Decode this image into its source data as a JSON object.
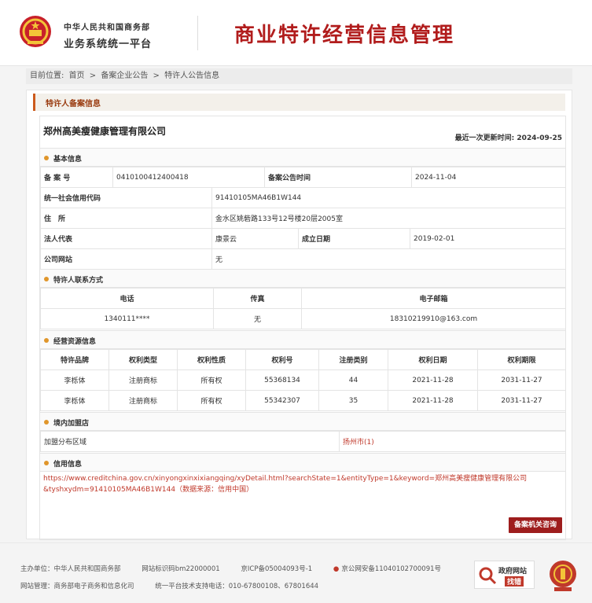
{
  "header": {
    "org_line1": "中华人民共和国商务部",
    "org_line2": "业务系统统一平台",
    "system_title": "商业特许经营信息管理"
  },
  "breadcrumb": {
    "prefix": "目前位置:",
    "items": [
      "首页",
      ">",
      "备案企业公告",
      ">",
      "特许人公告信息"
    ]
  },
  "panel_title": "特许人备案信息",
  "company": {
    "name": "郑州高美瘦健康管理有限公司",
    "updated_label": "最近一次更新时间:",
    "updated_value": "2024-09-25"
  },
  "basic": {
    "section_title": "基本信息",
    "record_no_label": "备 案 号",
    "record_no": "0410100412400418",
    "announce_time_label": "备案公告时间",
    "announce_time": "2024-11-04",
    "credit_code_label": "统一社会信用代码",
    "credit_code": "91410105MA46B1W144",
    "address_label": "住　所",
    "address": "金水区姚砦路133号12号楼20层2005室",
    "legal_rep_label": "法人代表",
    "legal_rep": "康景云",
    "founded_label": "成立日期",
    "founded": "2019-02-01",
    "website_label": "公司网站",
    "website": "无"
  },
  "contact": {
    "section_title": "特许人联系方式",
    "headers": [
      "电话",
      "传真",
      "电子邮箱"
    ],
    "phone": "1340111****",
    "fax": "无",
    "email": "18310219910@163.com"
  },
  "resources": {
    "section_title": "经营资源信息",
    "headers": [
      "特许品牌",
      "权利类型",
      "权利性质",
      "权利号",
      "注册类别",
      "权利日期",
      "权利期限"
    ],
    "rows": [
      [
        "李栎体",
        "注册商标",
        "所有权",
        "55368134",
        "44",
        "2021-11-28",
        "2031-11-27"
      ],
      [
        "李栎体",
        "注册商标",
        "所有权",
        "55342307",
        "35",
        "2021-11-28",
        "2031-11-27"
      ]
    ]
  },
  "domestic": {
    "section_title": "境内加盟店",
    "area_label": "加盟分布区域",
    "area_value": "扬州市(1)"
  },
  "credit": {
    "section_title": "信用信息",
    "text": "https://www.creditchina.gov.cn/xinyongxinxixiangqing/xyDetail.html?searchState=1&entityType=1&keyword=郑州高美瘦健康管理有限公司&tyshxydm=91410105MA46B1W144（数据来源：信用中国）"
  },
  "consult_button": "备案机关咨询",
  "footer": {
    "host": "主办单位：中华人民共和国商务部",
    "site_id": "网站标识码bm22000001",
    "icp": "京ICP备05004093号-1",
    "police": "京公网安备11040102700091号",
    "manager": "网站管理：商务部电子商务和信息化司",
    "support": "统一平台技术支持电话：010-67800108、67801644",
    "gov_badge_line1": "政府网站",
    "gov_badge_line2": "找错"
  },
  "colors": {
    "brand_red": "#b11c1c",
    "accent_orange": "#cc5a1c",
    "bullet": "#e0962b",
    "link_red": "#c0392b",
    "button": "#9e1d1d"
  }
}
